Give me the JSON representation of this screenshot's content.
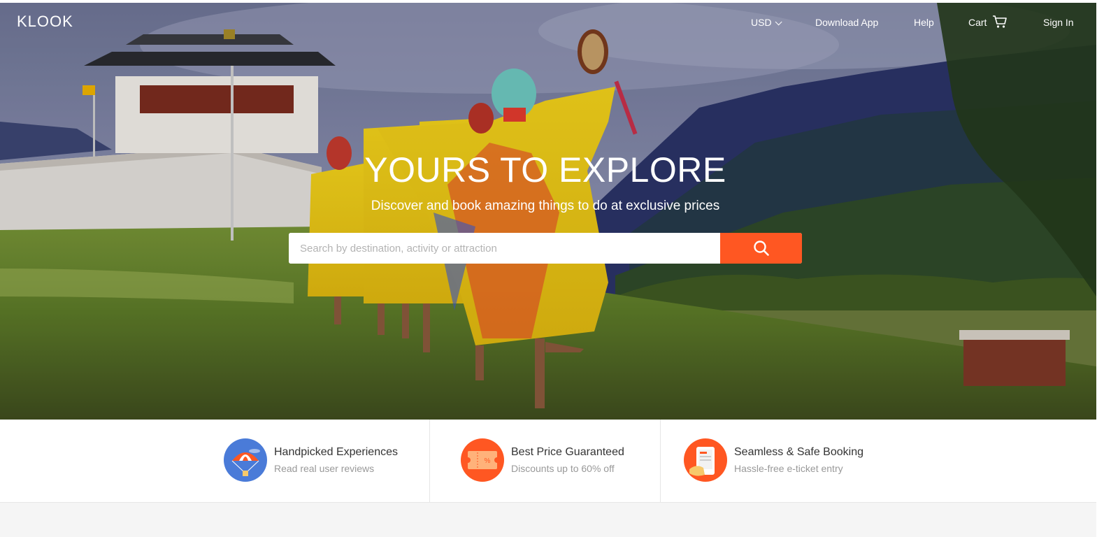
{
  "brand": {
    "logo": "KLOOK"
  },
  "header": {
    "currency": "USD",
    "download_app": "Download App",
    "help": "Help",
    "cart": "Cart",
    "sign_in": "Sign In"
  },
  "hero": {
    "title": "YOURS TO EXPLORE",
    "subtitle": "Discover and book amazing things to do at exclusive prices",
    "search_placeholder": "Search by destination, activity or attraction",
    "search_icon": "search-icon"
  },
  "features": [
    {
      "title": "Handpicked Experiences",
      "subtitle": "Read real user reviews",
      "icon": "parachute-icon",
      "icon_color": "#4a7bd8"
    },
    {
      "title": "Best Price Guaranteed",
      "subtitle": "Discounts up to 60% off",
      "icon": "ticket-icon",
      "icon_color": "#ff5722"
    },
    {
      "title": "Seamless & Safe Booking",
      "subtitle": "Hassle-free e-ticket entry",
      "icon": "phone-ticket-icon",
      "icon_color": "#ff5722"
    }
  ],
  "colors": {
    "accent": "#ff5722",
    "text_primary": "#333333",
    "text_secondary": "#999999"
  }
}
